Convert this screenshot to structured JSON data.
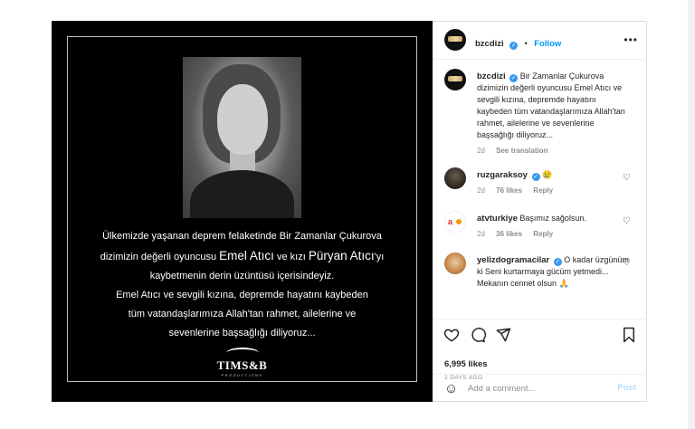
{
  "post": {
    "image": {
      "lines": [
        {
          "pre": "Ülkemizde yaşanan deprem felaketinde Bir Zamanlar Çukurova",
          "big1": "",
          "mid": "",
          "big2": "",
          "post": ""
        },
        {
          "pre": "dizimizin değerli oyuncusu ",
          "big1": "Emel Atıcı",
          "mid": " ve kızı ",
          "big2": "Püryan Atıcı",
          "post": "'yı"
        },
        {
          "pre": "kaybetmenin derin üzüntüsü içerisindeyiz.",
          "big1": "",
          "mid": "",
          "big2": "",
          "post": ""
        },
        {
          "pre": "Emel Atıcı ve sevgili kızına, depremde hayatını kaybeden",
          "big1": "",
          "mid": "",
          "big2": "",
          "post": ""
        },
        {
          "pre": "tüm vatandaşlarımıza Allah'tan rahmet, ailelerine ve",
          "big1": "",
          "mid": "",
          "big2": "",
          "post": ""
        },
        {
          "pre": "sevenlerine başsağlığı diliyoruz...",
          "big1": "",
          "mid": "",
          "big2": "",
          "post": ""
        }
      ],
      "logo": {
        "mark": "TIMS&B",
        "sub": "PRODUCTIONS"
      }
    },
    "header": {
      "username": "bzcdizi",
      "verified_glyph": "✓",
      "dot": "•",
      "follow": "Follow",
      "more": "•••"
    },
    "caption": {
      "username": "bzcdizi",
      "text": "Bir Zamanlar Çukurova dizimizin değerli oyuncusu Emel Atıcı ve sevgili kızına, depremde hayatını kaybeden tüm vatandaşlarımıza Allah'tan rahmet, ailelerine ve sevenlerine başsağlığı diliyoruz...",
      "age": "2d",
      "see_translation": "See translation"
    },
    "comments": [
      {
        "username": "ruzgaraksoy",
        "verified": true,
        "text": "😢",
        "age": "2d",
        "likes": "76 likes",
        "reply": "Reply"
      },
      {
        "username": "atvturkiye",
        "verified": false,
        "text": "Başımız sağolsun.",
        "age": "2d",
        "likes": "36 likes",
        "reply": "Reply"
      },
      {
        "username": "yelizdogramacilar",
        "verified": true,
        "text": "O kadar üzgünüm ki Seni kurtarmaya gücüm yetmedi... Mekanın cennet olsun 🙏",
        "age": "",
        "likes": "",
        "reply": ""
      }
    ],
    "actions": {
      "like_icon": "heart-icon",
      "comment_icon": "comment-icon",
      "share_icon": "share-icon",
      "save_icon": "bookmark-icon"
    },
    "likes": "6,995 likes",
    "date": "2 DAYS AGO",
    "add_comment": {
      "emoji_icon": "☺",
      "placeholder": "Add a comment...",
      "post": "Post"
    }
  }
}
